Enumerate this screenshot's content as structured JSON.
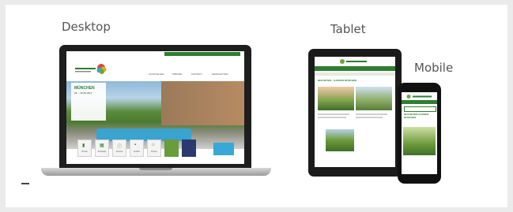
{
  "labels": {
    "desktop": "Desktop",
    "tablet": "Tablet",
    "mobile": "Mobile"
  },
  "colors": {
    "brand_green": "#2f7d32",
    "card_bg": "#ffffff",
    "page_bg": "#ebebeb"
  },
  "desktop_site": {
    "nav": [
      "AUSSTELLER",
      "PRESSE",
      "KONTAKT",
      "NEWSLETTER"
    ],
    "promo_title": "MÜNCHEN",
    "promo_date": "28. – 30.09.2017",
    "tiles": [
      {
        "icon": "ticket-icon",
        "label": "Tickets"
      },
      {
        "icon": "calendar-icon",
        "label": "Aussteller"
      },
      {
        "icon": "info-icon",
        "label": "Anreise"
      },
      {
        "icon": "seat-icon",
        "label": "Anfahrt"
      },
      {
        "icon": "hall-icon",
        "label": "Presse"
      }
    ]
  },
  "tablet_site": {
    "headline": "NEUHEITEN · GARDEN MÜNCHEN"
  },
  "mobile_site": {
    "headline": "NEUHEITEN GARDEN MÜNCHEN"
  }
}
